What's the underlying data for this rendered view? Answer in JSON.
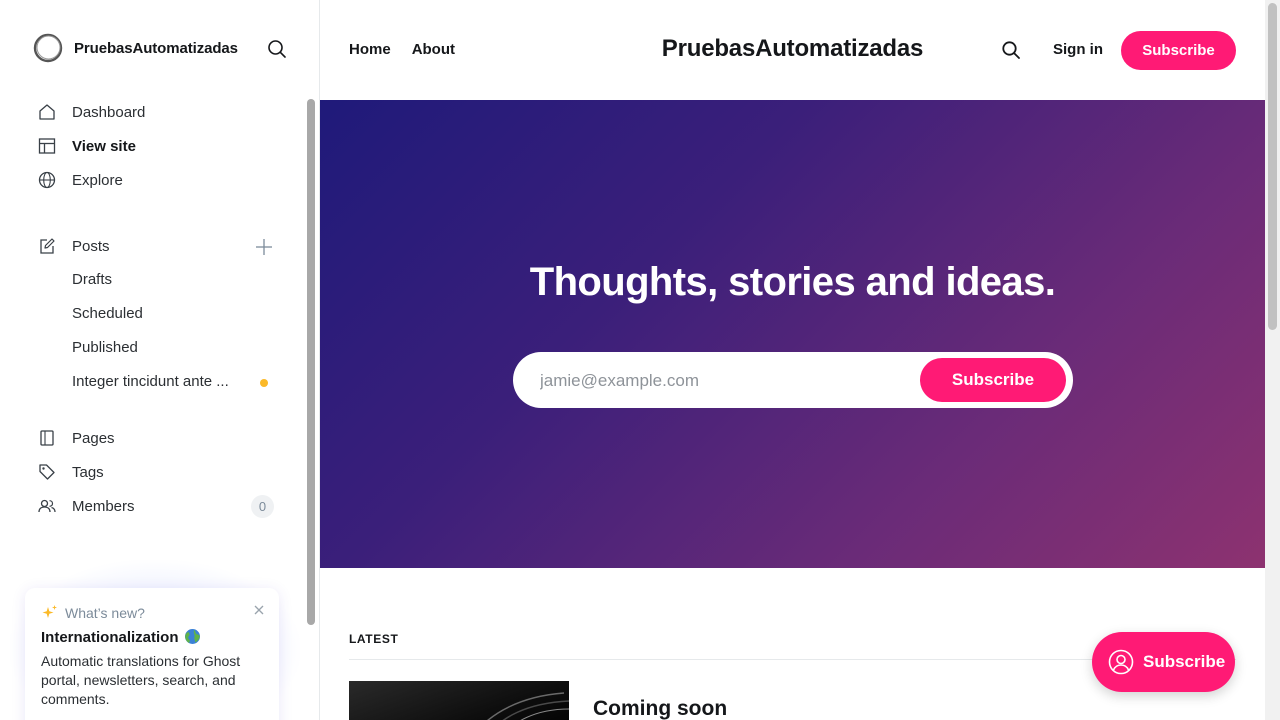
{
  "sidebar": {
    "site_name": "PruebasAutomatizadas",
    "nav": {
      "dashboard": "Dashboard",
      "view_site": "View site",
      "explore": "Explore",
      "posts": "Posts",
      "drafts": "Drafts",
      "scheduled": "Scheduled",
      "published": "Published",
      "draft_post": "Integer tincidunt ante ...",
      "pages": "Pages",
      "tags": "Tags",
      "members": "Members",
      "members_count": "0"
    },
    "whats_new": {
      "label": "What’s new?",
      "title": "Internationalization",
      "body": "Automatic translations for Ghost portal, newsletters, search, and comments."
    },
    "colors": {
      "active_dot": "#fbb928"
    }
  },
  "site": {
    "nav": {
      "home": "Home",
      "about": "About"
    },
    "title": "PruebasAutomatizadas",
    "sign_in": "Sign in",
    "subscribe": "Subscribe",
    "hero": {
      "title": "Thoughts, stories and ideas.",
      "email_placeholder": "jamie@example.com",
      "subscribe": "Subscribe"
    },
    "latest_label": "LATEST",
    "first_post_title": "Coming soon",
    "portal_button": "Subscribe",
    "colors": {
      "accent": "#ff1a75"
    }
  }
}
